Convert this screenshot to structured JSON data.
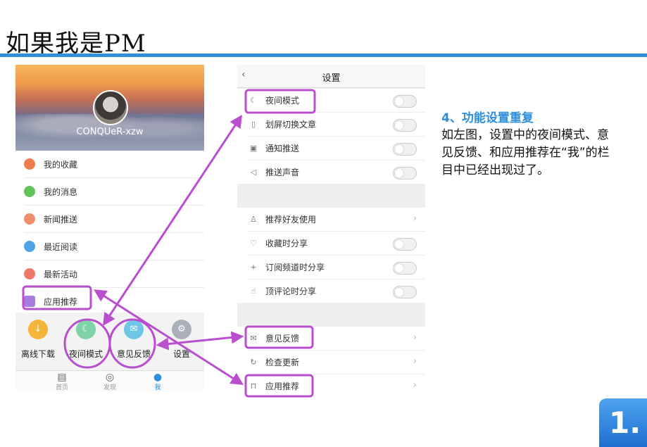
{
  "slide": {
    "title": "如果我是PM"
  },
  "left_phone": {
    "username": "CONQUeR-xzw",
    "menu": [
      {
        "label": "我的收藏",
        "icon": "star-icon",
        "color": "#f07d4a"
      },
      {
        "label": "我的消息",
        "icon": "message-icon",
        "color": "#5fc45a"
      },
      {
        "label": "新闻推送",
        "icon": "push-icon",
        "color": "#f0906a"
      },
      {
        "label": "最近阅读",
        "icon": "book-icon",
        "color": "#4fa4e8"
      },
      {
        "label": "最新活动",
        "icon": "gift-icon",
        "color": "#f07868"
      },
      {
        "label": "应用推荐",
        "icon": "bag-icon",
        "color": "#a77de0"
      }
    ],
    "quick": [
      {
        "label": "离线下载",
        "icon": "download-icon",
        "color": "#f4b53a",
        "glyph": "↓"
      },
      {
        "label": "夜间模式",
        "icon": "moon-icon",
        "color": "#7fd3a8",
        "glyph": "☾"
      },
      {
        "label": "意见反馈",
        "icon": "mail-icon",
        "color": "#6fc6e6",
        "glyph": "✉"
      },
      {
        "label": "设置",
        "icon": "gear-icon",
        "color": "#aab1bb",
        "glyph": "⚙"
      }
    ],
    "tabs": [
      {
        "label": "首页",
        "icon": "home-icon",
        "glyph": "▤"
      },
      {
        "label": "发现",
        "icon": "compass-icon",
        "glyph": "◎"
      },
      {
        "label": "我",
        "icon": "person-icon",
        "glyph": "●"
      }
    ]
  },
  "right_phone": {
    "back": "‹",
    "title": "设置",
    "group1": [
      {
        "label": "夜间模式",
        "icon": "moon-icon",
        "glyph": "☾"
      },
      {
        "label": "划屏切换文章",
        "icon": "swipe-icon",
        "glyph": "▯"
      },
      {
        "label": "通知推送",
        "icon": "notification-icon",
        "glyph": "▣"
      },
      {
        "label": "推送声音",
        "icon": "speaker-icon",
        "glyph": "◁"
      }
    ],
    "group2": [
      {
        "label": "推荐好友使用",
        "icon": "user-icon",
        "glyph": "♙",
        "control": "chevron"
      },
      {
        "label": "收藏时分享",
        "icon": "heart-icon",
        "glyph": "♡",
        "control": "toggle"
      },
      {
        "label": "订阅频道时分享",
        "icon": "plus-icon",
        "glyph": "+",
        "control": "toggle"
      },
      {
        "label": "顶评论时分享",
        "icon": "thumb-icon",
        "glyph": "☝",
        "control": "toggle"
      }
    ],
    "group3": [
      {
        "label": "意见反馈",
        "icon": "mail-icon",
        "glyph": "✉"
      },
      {
        "label": "检查更新",
        "icon": "refresh-icon",
        "glyph": "↻"
      },
      {
        "label": "应用推荐",
        "icon": "bag-icon",
        "glyph": "⊓"
      }
    ],
    "chevron": "›"
  },
  "note": {
    "heading": "4、功能设置重复",
    "body": "如左图，设置中的夜间模式、意见反馈、和应用推荐在“我”的栏目中已经出现过了。"
  },
  "badge": {
    "text": "1."
  },
  "colors": {
    "accent": "#2f8fdd",
    "annotation": "#b94fcf"
  }
}
